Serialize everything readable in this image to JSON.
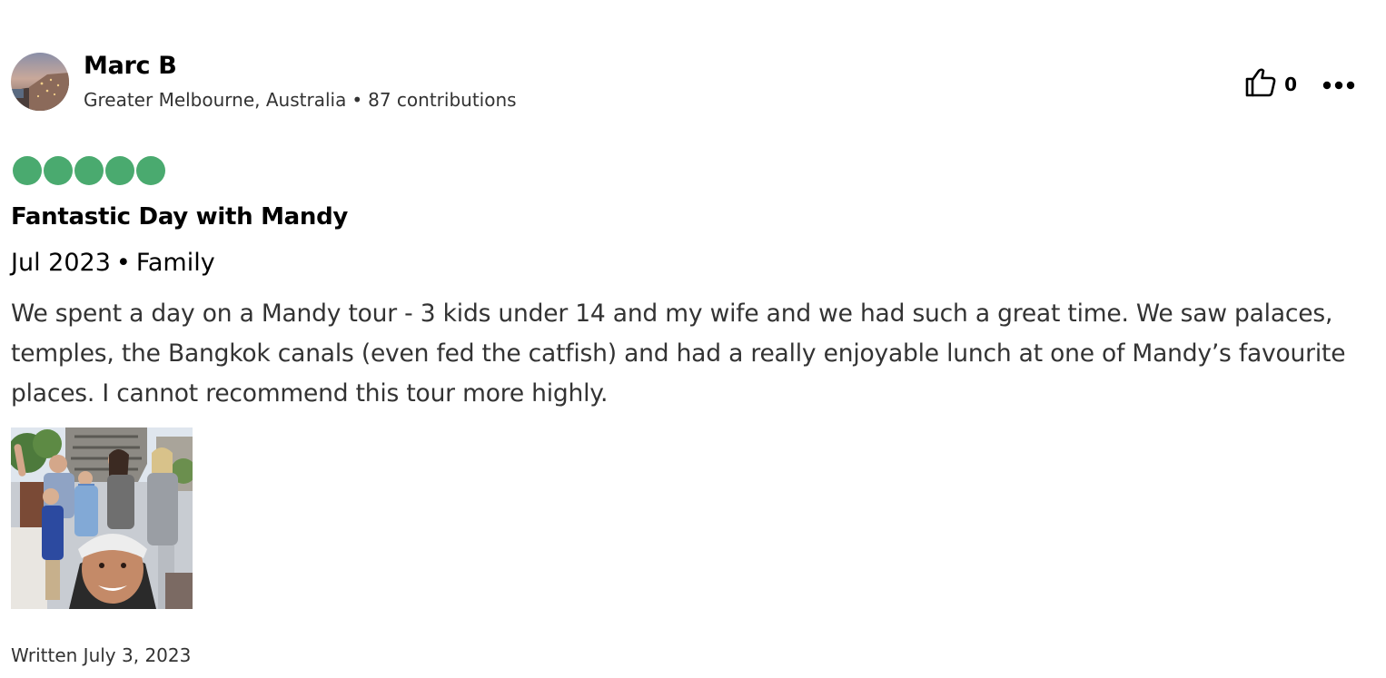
{
  "reviewer": {
    "name": "Marc B",
    "location": "Greater Melbourne, Australia",
    "separator": "•",
    "contributions": "87 contributions",
    "avatar_icon": "avatar-photo"
  },
  "actions": {
    "helpful_icon": "thumbs-up-icon",
    "helpful_count": "0",
    "more_icon": "more-options-icon"
  },
  "rating": {
    "value": 5,
    "max": 5,
    "color": "#4AAA6F"
  },
  "review": {
    "title": "Fantastic Day with Mandy",
    "date": "Jul 2023",
    "separator": "•",
    "trip_type": "Family",
    "text": "We spent a day on a Mandy tour - 3 kids under 14 and my wife and we had such a great time. We saw palaces, temples, the Bangkok canals (even fed the catfish) and had a really enjoyable lunch at one of Mandy’s favourite places. I cannot recommend this tour more highly.",
    "written": "Written July 3, 2023"
  },
  "photos": [
    {
      "icon": "review-photo"
    }
  ]
}
